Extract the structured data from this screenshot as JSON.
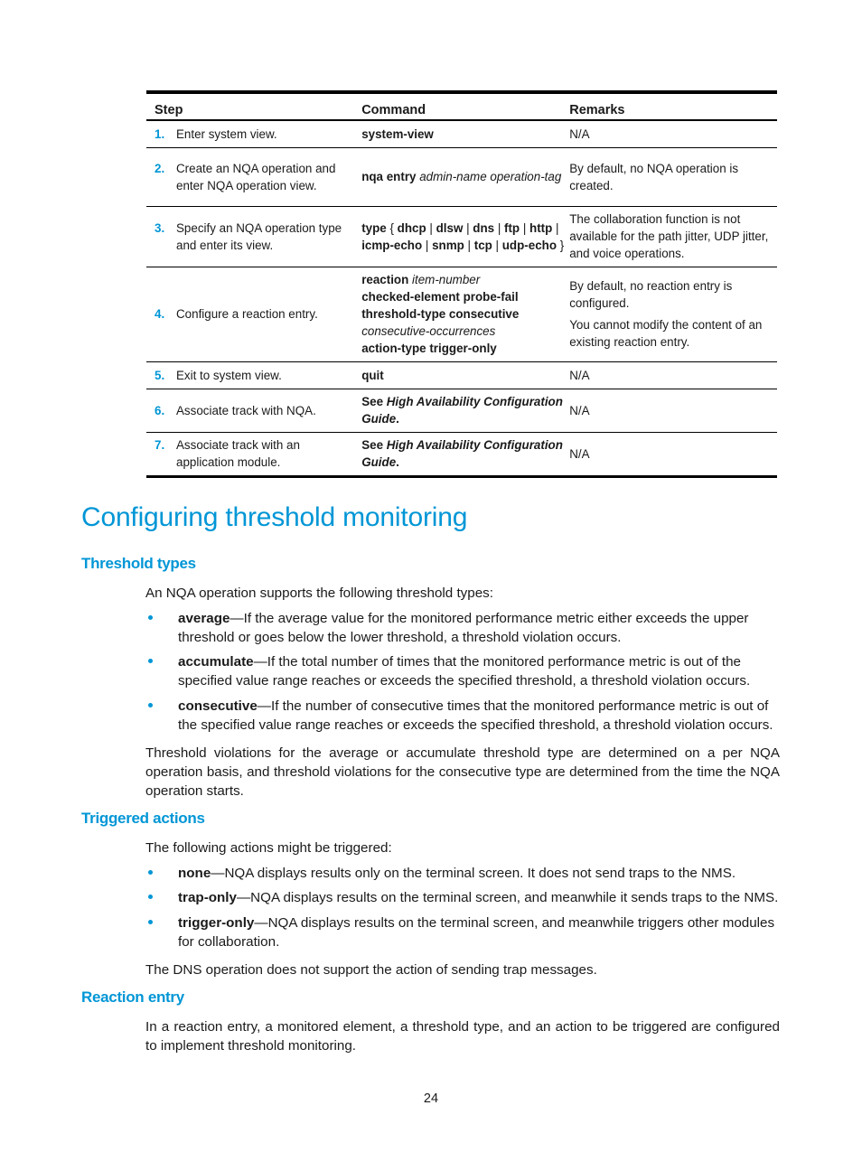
{
  "table": {
    "headers": {
      "step": "Step",
      "command": "Command",
      "remarks": "Remarks"
    },
    "rows": [
      {
        "num": "1.",
        "step": "Enter system view.",
        "command": [
          {
            "t": "system-view",
            "s": "b"
          }
        ],
        "remarks": [
          "N/A"
        ]
      },
      {
        "num": "2.",
        "step": "Create an NQA operation and enter NQA operation view.",
        "command": [
          {
            "t": "nqa entry",
            "s": "b"
          },
          {
            "t": " ",
            "s": "n"
          },
          {
            "t": "admin-name operation-tag",
            "s": "i"
          }
        ],
        "remarks": [
          "By default, no NQA operation is created."
        ]
      },
      {
        "num": "3.",
        "step": "Specify an NQA operation type and enter its view.",
        "command": [
          {
            "t": "type",
            "s": "b"
          },
          {
            "t": " { ",
            "s": "n"
          },
          {
            "t": "dhcp",
            "s": "b"
          },
          {
            "t": " | ",
            "s": "n"
          },
          {
            "t": "dlsw",
            "s": "b"
          },
          {
            "t": " | ",
            "s": "n"
          },
          {
            "t": "dns",
            "s": "b"
          },
          {
            "t": " | ",
            "s": "n"
          },
          {
            "t": "ftp",
            "s": "b"
          },
          {
            "t": " | ",
            "s": "n"
          },
          {
            "t": "http",
            "s": "b"
          },
          {
            "t": " | ",
            "s": "n"
          },
          {
            "t": "icmp-echo",
            "s": "b"
          },
          {
            "t": " | ",
            "s": "n"
          },
          {
            "t": "snmp",
            "s": "b"
          },
          {
            "t": " | ",
            "s": "n"
          },
          {
            "t": "tcp",
            "s": "b"
          },
          {
            "t": " | ",
            "s": "n"
          },
          {
            "t": "udp-echo",
            "s": "b"
          },
          {
            "t": " }",
            "s": "n"
          }
        ],
        "remarks": [
          "The collaboration function is not available for the path jitter, UDP jitter, and voice operations."
        ]
      },
      {
        "num": "4.",
        "step": "Configure a reaction entry.",
        "command": [
          {
            "t": "reaction",
            "s": "b"
          },
          {
            "t": " ",
            "s": "n"
          },
          {
            "t": "item-number",
            "s": "i"
          },
          {
            "t": "\n",
            "s": "br"
          },
          {
            "t": "checked-element probe-fail",
            "s": "b"
          },
          {
            "t": "\n",
            "s": "br"
          },
          {
            "t": "threshold-type consecutive",
            "s": "b"
          },
          {
            "t": "\n",
            "s": "br"
          },
          {
            "t": "consecutive-occurrences",
            "s": "i"
          },
          {
            "t": "\n",
            "s": "br"
          },
          {
            "t": "action-type trigger-only",
            "s": "b"
          }
        ],
        "remarks": [
          "By default, no reaction entry is configured.",
          "You cannot modify the content of an existing reaction entry."
        ]
      },
      {
        "num": "5.",
        "step": "Exit to system view.",
        "command": [
          {
            "t": "quit",
            "s": "b"
          }
        ],
        "remarks": [
          "N/A"
        ]
      },
      {
        "num": "6.",
        "step": "Associate track with NQA.",
        "command": [
          {
            "t": "See ",
            "s": "b"
          },
          {
            "t": "High Availability Configuration Guide",
            "s": "bi"
          },
          {
            "t": ".",
            "s": "b"
          }
        ],
        "remarks": [
          "N/A"
        ]
      },
      {
        "num": "7.",
        "step": "Associate track with an application module.",
        "command": [
          {
            "t": "See ",
            "s": "b"
          },
          {
            "t": "High Availability Configuration Guide",
            "s": "bi"
          },
          {
            "t": ".",
            "s": "b"
          }
        ],
        "remarks": [
          "N/A"
        ]
      }
    ]
  },
  "section": {
    "title": "Configuring threshold monitoring",
    "threshold_types": {
      "heading": "Threshold types",
      "intro": "An NQA operation supports the following threshold types:",
      "items": [
        {
          "term": "average",
          "text": "—If the average value for the monitored performance metric either exceeds the upper threshold or goes below the lower threshold, a threshold violation occurs."
        },
        {
          "term": "accumulate",
          "text": "—If the total number of times that the monitored performance metric is out of the specified value range reaches or exceeds the specified threshold, a threshold violation occurs."
        },
        {
          "term": "consecutive",
          "text": "—If the number of consecutive times that the monitored performance metric is out of the specified value range reaches or exceeds the specified threshold, a threshold violation occurs."
        }
      ],
      "note": "Threshold violations for the average or accumulate threshold type are determined on a per NQA operation basis, and threshold violations for the consecutive type are determined from the time the NQA operation starts."
    },
    "triggered_actions": {
      "heading": "Triggered actions",
      "intro": "The following actions might be triggered:",
      "items": [
        {
          "term": "none",
          "text": "—NQA displays results only on the terminal screen. It does not send traps to the NMS."
        },
        {
          "term": "trap-only",
          "text": "—NQA displays results on the terminal screen, and meanwhile it sends traps to the NMS."
        },
        {
          "term": "trigger-only",
          "text": "—NQA displays results on the terminal screen, and meanwhile triggers other modules for collaboration."
        }
      ],
      "note": "The DNS operation does not support the action of sending trap messages."
    },
    "reaction_entry": {
      "heading": "Reaction entry",
      "text": "In a reaction entry, a monitored element, a threshold type, and an action to be triggered are configured to implement threshold monitoring."
    }
  },
  "page_number": "24",
  "colors": {
    "accent": "#0096d6",
    "text": "#1a1a1a"
  }
}
